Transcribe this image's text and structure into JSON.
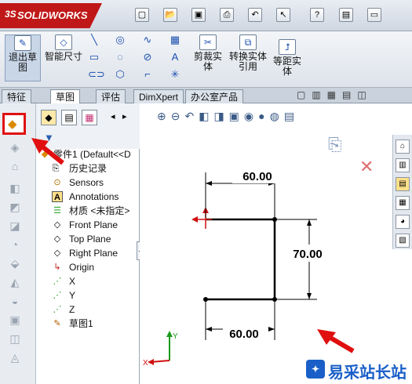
{
  "app": {
    "brand": "SOLIDWORKS",
    "brand_prefix": "3S"
  },
  "ribbon": {
    "exit_sketch": "退出草图",
    "smart_dim": "智能尺寸",
    "trim": "剪裁实体",
    "convert": "转换实体引用",
    "offset": "等距实体"
  },
  "tabs": [
    "特征",
    "草图",
    "评估",
    "DimXpert",
    "办公室产品"
  ],
  "active_tab": "草图",
  "filter_icon": "filter-icon",
  "tree": {
    "part": "零件1 (Default<<D",
    "items": [
      "历史记录",
      "Sensors",
      "Annotations",
      "材质 <未指定>",
      "Front Plane",
      "Top Plane",
      "Right Plane",
      "Origin",
      "X",
      "Y",
      "Z",
      "草图1"
    ]
  },
  "dimensions": {
    "top": "60.00",
    "right": "70.00",
    "bottom": "60.00"
  },
  "axes": {
    "x": "X",
    "y": "Y"
  },
  "watermark": {
    "text": "易采站长站"
  },
  "colors": {
    "highlight": "#e01010",
    "brand": "#c01818",
    "axis_green": "#1a9a1a",
    "axis_red": "#d01010"
  }
}
